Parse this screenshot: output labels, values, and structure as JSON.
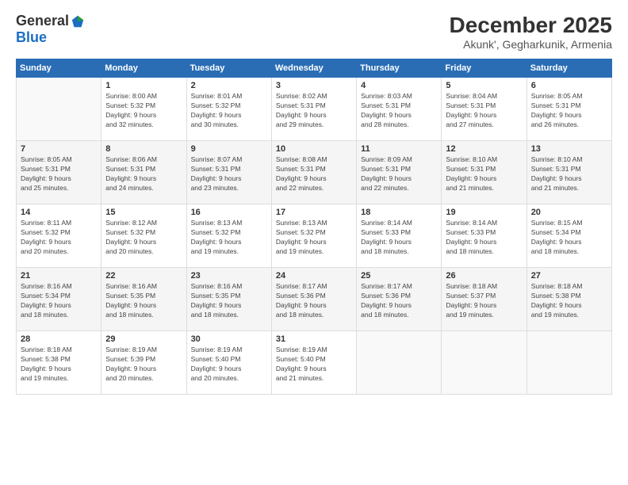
{
  "logo": {
    "general": "General",
    "blue": "Blue"
  },
  "title": "December 2025",
  "subtitle": "Akunk', Gegharkunik, Armenia",
  "weekdays": [
    "Sunday",
    "Monday",
    "Tuesday",
    "Wednesday",
    "Thursday",
    "Friday",
    "Saturday"
  ],
  "weeks": [
    [
      {
        "day": "",
        "info": []
      },
      {
        "day": "1",
        "info": [
          "Sunrise: 8:00 AM",
          "Sunset: 5:32 PM",
          "Daylight: 9 hours",
          "and 32 minutes."
        ]
      },
      {
        "day": "2",
        "info": [
          "Sunrise: 8:01 AM",
          "Sunset: 5:32 PM",
          "Daylight: 9 hours",
          "and 30 minutes."
        ]
      },
      {
        "day": "3",
        "info": [
          "Sunrise: 8:02 AM",
          "Sunset: 5:31 PM",
          "Daylight: 9 hours",
          "and 29 minutes."
        ]
      },
      {
        "day": "4",
        "info": [
          "Sunrise: 8:03 AM",
          "Sunset: 5:31 PM",
          "Daylight: 9 hours",
          "and 28 minutes."
        ]
      },
      {
        "day": "5",
        "info": [
          "Sunrise: 8:04 AM",
          "Sunset: 5:31 PM",
          "Daylight: 9 hours",
          "and 27 minutes."
        ]
      },
      {
        "day": "6",
        "info": [
          "Sunrise: 8:05 AM",
          "Sunset: 5:31 PM",
          "Daylight: 9 hours",
          "and 26 minutes."
        ]
      }
    ],
    [
      {
        "day": "7",
        "info": [
          "Sunrise: 8:05 AM",
          "Sunset: 5:31 PM",
          "Daylight: 9 hours",
          "and 25 minutes."
        ]
      },
      {
        "day": "8",
        "info": [
          "Sunrise: 8:06 AM",
          "Sunset: 5:31 PM",
          "Daylight: 9 hours",
          "and 24 minutes."
        ]
      },
      {
        "day": "9",
        "info": [
          "Sunrise: 8:07 AM",
          "Sunset: 5:31 PM",
          "Daylight: 9 hours",
          "and 23 minutes."
        ]
      },
      {
        "day": "10",
        "info": [
          "Sunrise: 8:08 AM",
          "Sunset: 5:31 PM",
          "Daylight: 9 hours",
          "and 22 minutes."
        ]
      },
      {
        "day": "11",
        "info": [
          "Sunrise: 8:09 AM",
          "Sunset: 5:31 PM",
          "Daylight: 9 hours",
          "and 22 minutes."
        ]
      },
      {
        "day": "12",
        "info": [
          "Sunrise: 8:10 AM",
          "Sunset: 5:31 PM",
          "Daylight: 9 hours",
          "and 21 minutes."
        ]
      },
      {
        "day": "13",
        "info": [
          "Sunrise: 8:10 AM",
          "Sunset: 5:31 PM",
          "Daylight: 9 hours",
          "and 21 minutes."
        ]
      }
    ],
    [
      {
        "day": "14",
        "info": [
          "Sunrise: 8:11 AM",
          "Sunset: 5:32 PM",
          "Daylight: 9 hours",
          "and 20 minutes."
        ]
      },
      {
        "day": "15",
        "info": [
          "Sunrise: 8:12 AM",
          "Sunset: 5:32 PM",
          "Daylight: 9 hours",
          "and 20 minutes."
        ]
      },
      {
        "day": "16",
        "info": [
          "Sunrise: 8:13 AM",
          "Sunset: 5:32 PM",
          "Daylight: 9 hours",
          "and 19 minutes."
        ]
      },
      {
        "day": "17",
        "info": [
          "Sunrise: 8:13 AM",
          "Sunset: 5:32 PM",
          "Daylight: 9 hours",
          "and 19 minutes."
        ]
      },
      {
        "day": "18",
        "info": [
          "Sunrise: 8:14 AM",
          "Sunset: 5:33 PM",
          "Daylight: 9 hours",
          "and 18 minutes."
        ]
      },
      {
        "day": "19",
        "info": [
          "Sunrise: 8:14 AM",
          "Sunset: 5:33 PM",
          "Daylight: 9 hours",
          "and 18 minutes."
        ]
      },
      {
        "day": "20",
        "info": [
          "Sunrise: 8:15 AM",
          "Sunset: 5:34 PM",
          "Daylight: 9 hours",
          "and 18 minutes."
        ]
      }
    ],
    [
      {
        "day": "21",
        "info": [
          "Sunrise: 8:16 AM",
          "Sunset: 5:34 PM",
          "Daylight: 9 hours",
          "and 18 minutes."
        ]
      },
      {
        "day": "22",
        "info": [
          "Sunrise: 8:16 AM",
          "Sunset: 5:35 PM",
          "Daylight: 9 hours",
          "and 18 minutes."
        ]
      },
      {
        "day": "23",
        "info": [
          "Sunrise: 8:16 AM",
          "Sunset: 5:35 PM",
          "Daylight: 9 hours",
          "and 18 minutes."
        ]
      },
      {
        "day": "24",
        "info": [
          "Sunrise: 8:17 AM",
          "Sunset: 5:36 PM",
          "Daylight: 9 hours",
          "and 18 minutes."
        ]
      },
      {
        "day": "25",
        "info": [
          "Sunrise: 8:17 AM",
          "Sunset: 5:36 PM",
          "Daylight: 9 hours",
          "and 18 minutes."
        ]
      },
      {
        "day": "26",
        "info": [
          "Sunrise: 8:18 AM",
          "Sunset: 5:37 PM",
          "Daylight: 9 hours",
          "and 19 minutes."
        ]
      },
      {
        "day": "27",
        "info": [
          "Sunrise: 8:18 AM",
          "Sunset: 5:38 PM",
          "Daylight: 9 hours",
          "and 19 minutes."
        ]
      }
    ],
    [
      {
        "day": "28",
        "info": [
          "Sunrise: 8:18 AM",
          "Sunset: 5:38 PM",
          "Daylight: 9 hours",
          "and 19 minutes."
        ]
      },
      {
        "day": "29",
        "info": [
          "Sunrise: 8:19 AM",
          "Sunset: 5:39 PM",
          "Daylight: 9 hours",
          "and 20 minutes."
        ]
      },
      {
        "day": "30",
        "info": [
          "Sunrise: 8:19 AM",
          "Sunset: 5:40 PM",
          "Daylight: 9 hours",
          "and 20 minutes."
        ]
      },
      {
        "day": "31",
        "info": [
          "Sunrise: 8:19 AM",
          "Sunset: 5:40 PM",
          "Daylight: 9 hours",
          "and 21 minutes."
        ]
      },
      {
        "day": "",
        "info": []
      },
      {
        "day": "",
        "info": []
      },
      {
        "day": "",
        "info": []
      }
    ]
  ]
}
